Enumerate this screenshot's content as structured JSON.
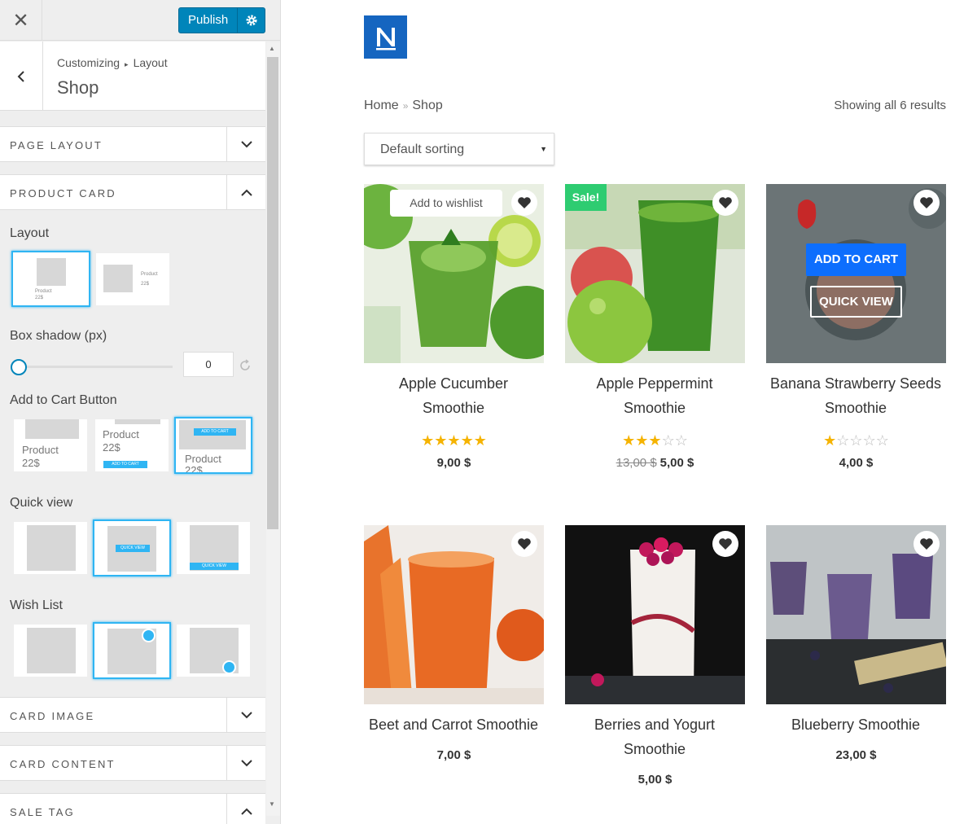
{
  "topbar": {
    "close_icon": "close-icon",
    "publish_label": "Publish",
    "gear_icon": "gear-icon"
  },
  "panel": {
    "crumb_a": "Customizing",
    "crumb_b": "Layout",
    "title": "Shop"
  },
  "sections": {
    "page_layout": "PAGE LAYOUT",
    "product_card": "PRODUCT CARD",
    "card_image": "CARD IMAGE",
    "card_content": "CARD CONTENT",
    "sale_tag": "SALE TAG"
  },
  "product_card": {
    "layout_label": "Layout",
    "layout_opt_product": "Product",
    "layout_opt_price": "22$",
    "box_shadow_label": "Box shadow (px)",
    "box_shadow_value": "0",
    "atc_label": "Add to Cart Button",
    "atc_product": "Product",
    "atc_price": "22$",
    "atc_btn": "ADD TO CART",
    "quick_view_label": "Quick view",
    "qv_btn": "QUICK VIEW",
    "wish_list_label": "Wish List"
  },
  "shop": {
    "breadcrumb_home": "Home",
    "breadcrumb_sep": "»",
    "breadcrumb_current": "Shop",
    "results": "Showing all 6 results",
    "sorting": "Default sorting",
    "add_to_wishlist_tip": "Add to wishlist",
    "sale_badge": "Sale!",
    "add_to_cart": "ADD TO CART",
    "quick_view": "QUICK VIEW"
  },
  "products": [
    {
      "name1": "Apple Cucumber",
      "name2": "Smoothie",
      "rating": 5,
      "price": "9,00 $"
    },
    {
      "name1": "Apple Peppermint",
      "name2": "Smoothie",
      "rating": 3,
      "old_price": "13,00 $",
      "price": "5,00 $"
    },
    {
      "name1": "Banana Strawberry Seeds",
      "name2": "Smoothie",
      "rating": 1,
      "price": "4,00 $"
    },
    {
      "name1": "Beet and Carrot Smoothie",
      "name2": "",
      "price": "7,00 $"
    },
    {
      "name1": "Berries and Yogurt",
      "name2": "Smoothie",
      "price": "5,00 $"
    },
    {
      "name1": "Blueberry Smoothie",
      "name2": "",
      "price": "23,00 $"
    }
  ],
  "colors": {
    "accent": "#0085ba",
    "selected": "#2fb5f3",
    "star": "#f5b301",
    "sale": "#2ecc71",
    "cart": "#0d6efd"
  }
}
